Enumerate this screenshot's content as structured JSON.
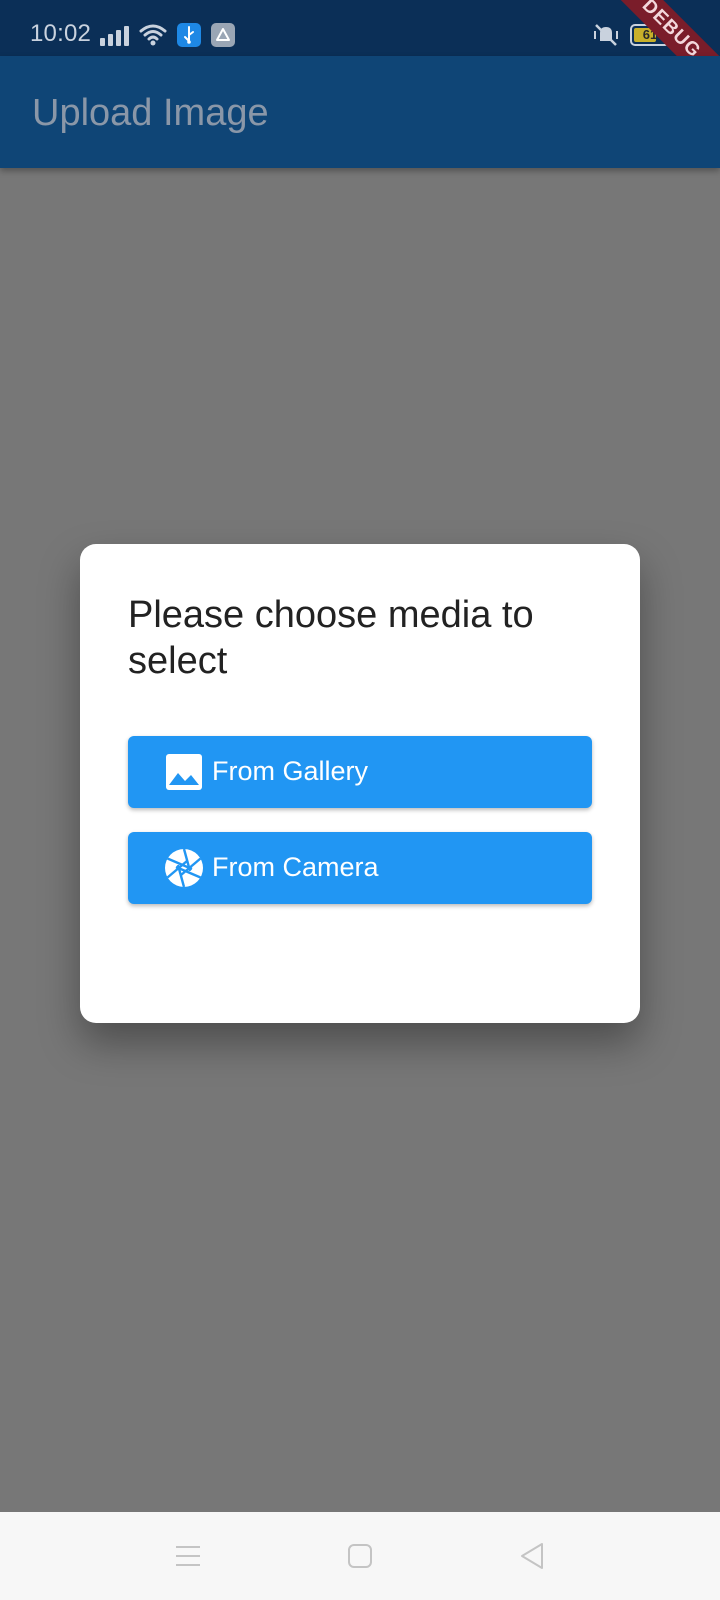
{
  "status_bar": {
    "time": "10:02",
    "battery_level": "61",
    "icons": [
      "signal-icon",
      "wifi-icon",
      "usb-icon",
      "drive-icon",
      "vibrate-icon",
      "battery-icon",
      "charging-icon"
    ]
  },
  "debug_banner": "DEBUG",
  "app_bar": {
    "title": "Upload Image"
  },
  "dialog": {
    "title": "Please choose media to select",
    "buttons": [
      {
        "label": "From Gallery",
        "icon": "image-icon"
      },
      {
        "label": "From Camera",
        "icon": "camera-aperture-icon"
      }
    ]
  },
  "nav_bar": {
    "icons": [
      "menu-icon",
      "home-icon",
      "back-icon"
    ]
  },
  "colors": {
    "app_bar": "#0f4576",
    "status_bar": "#0b2f57",
    "button": "#2196f3",
    "scrim": "#777777",
    "debug_banner": "#7a1d2a"
  }
}
